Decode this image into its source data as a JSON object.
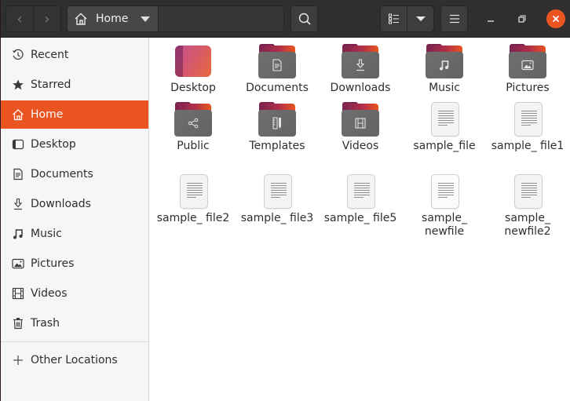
{
  "header": {
    "back_label": "‹",
    "forward_label": "›",
    "path_label": "Home",
    "search_tooltip": "Search",
    "view_mode": "list-view",
    "colors": {
      "close": "#e95420",
      "bar": "#2f2f2f"
    }
  },
  "sidebar": {
    "items": [
      {
        "label": "Recent",
        "icon": "clock-icon"
      },
      {
        "label": "Starred",
        "icon": "star-icon"
      },
      {
        "label": "Home",
        "icon": "home-icon",
        "active": true
      },
      {
        "label": "Desktop",
        "icon": "desktop-icon"
      },
      {
        "label": "Documents",
        "icon": "document-icon"
      },
      {
        "label": "Downloads",
        "icon": "download-icon"
      },
      {
        "label": "Music",
        "icon": "music-icon"
      },
      {
        "label": "Pictures",
        "icon": "picture-icon"
      },
      {
        "label": "Videos",
        "icon": "video-icon"
      },
      {
        "label": "Trash",
        "icon": "trash-icon"
      }
    ],
    "other_locations": {
      "label": "Other Locations",
      "icon": "plus-icon"
    },
    "accent": "#e95420"
  },
  "files": [
    {
      "name": "Desktop",
      "type": "desktop-folder"
    },
    {
      "name": "Documents",
      "type": "folder",
      "emblem": "document"
    },
    {
      "name": "Downloads",
      "type": "folder",
      "emblem": "download"
    },
    {
      "name": "Music",
      "type": "folder",
      "emblem": "music"
    },
    {
      "name": "Pictures",
      "type": "folder",
      "emblem": "picture"
    },
    {
      "name": "Public",
      "type": "folder",
      "emblem": "share"
    },
    {
      "name": "Templates",
      "type": "folder",
      "emblem": "template"
    },
    {
      "name": "Videos",
      "type": "folder",
      "emblem": "video"
    },
    {
      "name": "sample_file",
      "type": "text-file"
    },
    {
      "name": "sample_ file1",
      "type": "text-file"
    },
    {
      "name": "sample_ file2",
      "type": "text-file"
    },
    {
      "name": "sample_ file3",
      "type": "text-file"
    },
    {
      "name": "sample_ file5",
      "type": "text-file"
    },
    {
      "name": "sample_ newfile",
      "type": "text-file"
    },
    {
      "name": "sample_ newfile2",
      "type": "text-file"
    }
  ]
}
